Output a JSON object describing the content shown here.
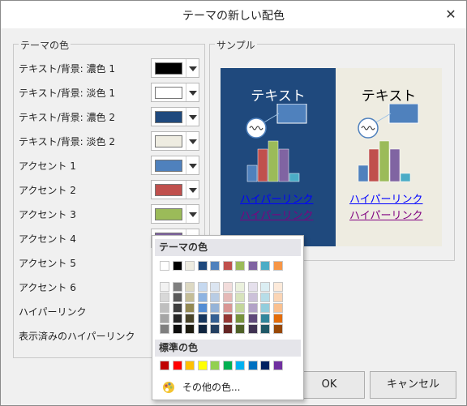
{
  "window": {
    "title": "テーマの新しい配色"
  },
  "theme_colors": {
    "legend": "テーマの色",
    "rows": [
      {
        "label": "テキスト/背景: 濃色 1",
        "color": "#000000"
      },
      {
        "label": "テキスト/背景: 淡色 1",
        "color": "#ffffff"
      },
      {
        "label": "テキスト/背景: 濃色 2",
        "color": "#1f497d"
      },
      {
        "label": "テキスト/背景: 淡色 2",
        "color": "#eeece1"
      },
      {
        "label": "アクセント 1",
        "color": "#4f81bd"
      },
      {
        "label": "アクセント 2",
        "color": "#c0504d"
      },
      {
        "label": "アクセント 3",
        "color": "#9bbb59"
      },
      {
        "label": "アクセント 4",
        "color": "#8064a2"
      },
      {
        "label": "アクセント 5",
        "color": ""
      },
      {
        "label": "アクセント 6",
        "color": ""
      },
      {
        "label": "ハイパーリンク",
        "color": ""
      },
      {
        "label": "表示済みのハイパーリンク",
        "color": ""
      }
    ]
  },
  "sample": {
    "legend": "サンプル",
    "dark": {
      "text": "テキスト",
      "link": "ハイパーリンク",
      "visited": "ハイパーリンク",
      "bg": "#1f497d",
      "text_color": "#ffffff",
      "link_color": "#0000ff",
      "visited_color": "#800080"
    },
    "light": {
      "text": "テキスト",
      "link": "ハイパーリンク",
      "visited": "ハイパーリンク",
      "bg": "#eeece1",
      "text_color": "#000000",
      "link_color": "#0000ff",
      "visited_color": "#800080"
    },
    "bars": [
      {
        "value": 2,
        "color": "#4f81bd"
      },
      {
        "value": 4,
        "color": "#c0504d"
      },
      {
        "value": 5,
        "color": "#9bbb59"
      },
      {
        "value": 4,
        "color": "#8064a2"
      },
      {
        "value": 1,
        "color": "#4bacc6"
      }
    ]
  },
  "buttons": {
    "ok": "OK",
    "cancel": "キャンセル"
  },
  "palette": {
    "theme_header": "テーマの色",
    "standard_header": "標準の色",
    "more_colors": "その他の色...",
    "theme_top": [
      "#ffffff",
      "#000000",
      "#eeece1",
      "#1f497d",
      "#4f81bd",
      "#c0504d",
      "#9bbb59",
      "#8064a2",
      "#4bacc6",
      "#f79646"
    ],
    "theme_shades": [
      [
        "#f2f2f2",
        "#7f7f7f",
        "#ddd9c3",
        "#c6d9f0",
        "#dbe5f1",
        "#f2dcdb",
        "#ebf1dd",
        "#e5e0ec",
        "#dbeef3",
        "#fdeada"
      ],
      [
        "#d8d8d8",
        "#595959",
        "#c4bd97",
        "#8db3e2",
        "#b8cce4",
        "#e5b9b7",
        "#d7e3bc",
        "#ccc1d9",
        "#b7dde8",
        "#fbd5b5"
      ],
      [
        "#bfbfbf",
        "#3f3f3f",
        "#938953",
        "#548dd4",
        "#95b3d7",
        "#d99694",
        "#c3d69b",
        "#b2a2c7",
        "#92cddc",
        "#fac08f"
      ],
      [
        "#a5a5a5",
        "#262626",
        "#494429",
        "#17365d",
        "#366092",
        "#953734",
        "#76923c",
        "#5f497a",
        "#31859b",
        "#e36c09"
      ],
      [
        "#7f7f7f",
        "#0c0c0c",
        "#1d1b10",
        "#0f243e",
        "#244061",
        "#632423",
        "#4f6128",
        "#3f3151",
        "#205867",
        "#974806"
      ]
    ],
    "standard": [
      "#c00000",
      "#ff0000",
      "#ffc000",
      "#ffff00",
      "#92d050",
      "#00b050",
      "#00b0f0",
      "#0070c0",
      "#002060",
      "#7030a0"
    ]
  }
}
